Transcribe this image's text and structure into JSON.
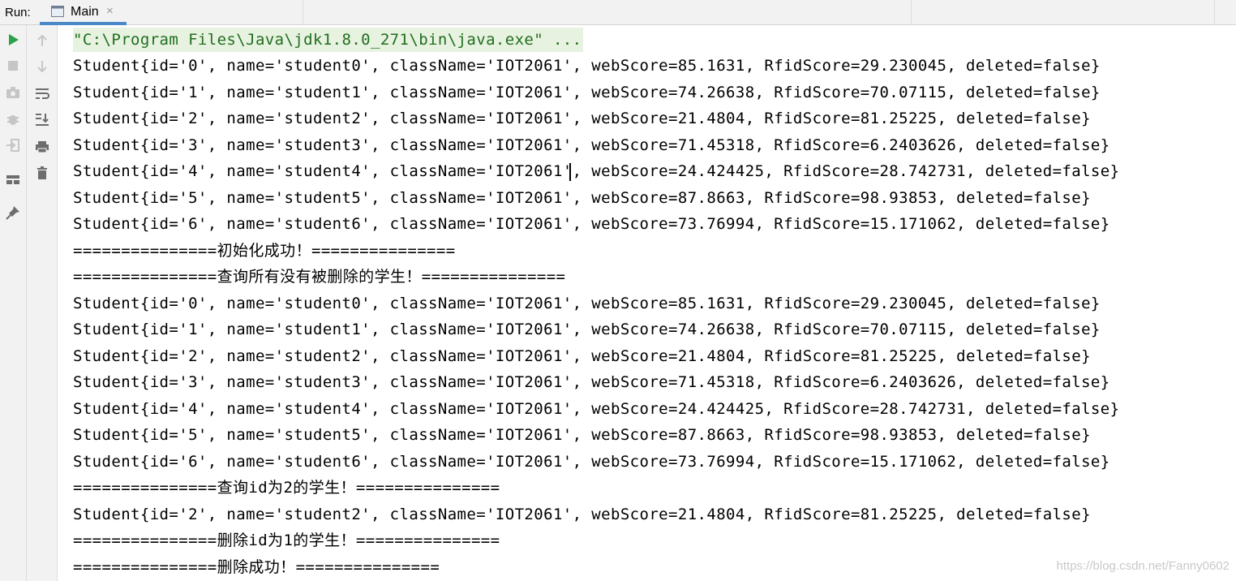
{
  "run": {
    "label": "Run:"
  },
  "tab": {
    "title": "Main",
    "close_symbol": "×",
    "icon": "console-window-icon"
  },
  "toolbar": {
    "left": [
      {
        "icon": "rerun-play-icon",
        "color": "#2ca24a"
      },
      {
        "icon": "stop-icon"
      },
      {
        "icon": "camera-icon"
      },
      {
        "icon": "debugger-icon"
      },
      {
        "icon": "exit-login-icon"
      },
      {
        "icon": "layout-icon"
      },
      {
        "icon": "pin-icon"
      }
    ],
    "right": [
      {
        "icon": "arrow-up-icon"
      },
      {
        "icon": "arrow-down-icon"
      },
      {
        "icon": "soft-wrap-icon"
      },
      {
        "icon": "scroll-to-end-icon"
      },
      {
        "icon": "print-icon"
      },
      {
        "icon": "trash-icon"
      }
    ]
  },
  "console": {
    "lines": [
      "\"C:\\Program Files\\Java\\jdk1.8.0_271\\bin\\java.exe\" ...",
      "Student{id='0', name='student0', className='IOT2061', webScore=85.1631, RfidScore=29.230045, deleted=false}",
      "Student{id='1', name='student1', className='IOT2061', webScore=74.26638, RfidScore=70.07115, deleted=false}",
      "Student{id='2', name='student2', className='IOT2061', webScore=21.4804, RfidScore=81.25225, deleted=false}",
      "Student{id='3', name='student3', className='IOT2061', webScore=71.45318, RfidScore=6.2403626, deleted=false}",
      "Student{id='4', name='student4', className='IOT2061', webScore=24.424425, RfidScore=28.742731, deleted=false}",
      "Student{id='5', name='student5', className='IOT2061', webScore=87.8663, RfidScore=98.93853, deleted=false}",
      "Student{id='6', name='student6', className='IOT2061', webScore=73.76994, RfidScore=15.171062, deleted=false}",
      "===============初始化成功！===============",
      "===============查询所有没有被删除的学生！===============",
      "Student{id='0', name='student0', className='IOT2061', webScore=85.1631, RfidScore=29.230045, deleted=false}",
      "Student{id='1', name='student1', className='IOT2061', webScore=74.26638, RfidScore=70.07115, deleted=false}",
      "Student{id='2', name='student2', className='IOT2061', webScore=21.4804, RfidScore=81.25225, deleted=false}",
      "Student{id='3', name='student3', className='IOT2061', webScore=71.45318, RfidScore=6.2403626, deleted=false}",
      "Student{id='4', name='student4', className='IOT2061', webScore=24.424425, RfidScore=28.742731, deleted=false}",
      "Student{id='5', name='student5', className='IOT2061', webScore=87.8663, RfidScore=98.93853, deleted=false}",
      "Student{id='6', name='student6', className='IOT2061', webScore=73.76994, RfidScore=15.171062, deleted=false}",
      "===============查询id为2的学生！===============",
      "Student{id='2', name='student2', className='IOT2061', webScore=21.4804, RfidScore=81.25225, deleted=false}",
      "===============删除id为1的学生！===============",
      "===============删除成功！==============="
    ]
  },
  "watermark": "https://blog.csdn.net/Fanny0602"
}
